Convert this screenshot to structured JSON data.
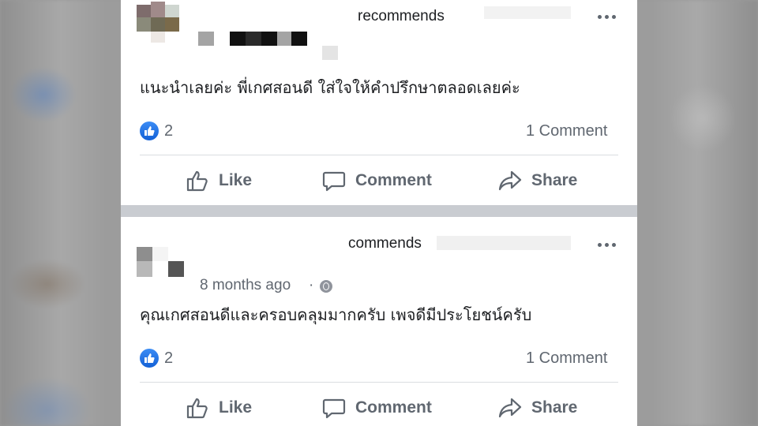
{
  "posts": [
    {
      "recommends_text": "recommends",
      "timestamp": "",
      "body": "แนะนำเลยค่ะ พี่เกศสอนดี ใส่ใจให้คำปรึกษาตลอดเลยค่ะ",
      "reaction_count": "2",
      "comment_count": "1 Comment"
    },
    {
      "recommends_text": "commends",
      "timestamp": "8 months ago",
      "body": "คุณเกศสอนดีและครอบคลุมมากครับ เพจดีมีประโยชน์ครับ",
      "reaction_count": "2",
      "comment_count": "1 Comment"
    }
  ],
  "actions": {
    "like": "Like",
    "comment": "Comment",
    "share": "Share"
  },
  "colors": {
    "like_blue": "#1877f2",
    "text_secondary": "#606770",
    "separator": "#c9ccd1"
  },
  "icons": [
    "like-icon",
    "comment-icon",
    "share-icon",
    "more-icon",
    "globe-icon",
    "like-reaction-icon"
  ]
}
